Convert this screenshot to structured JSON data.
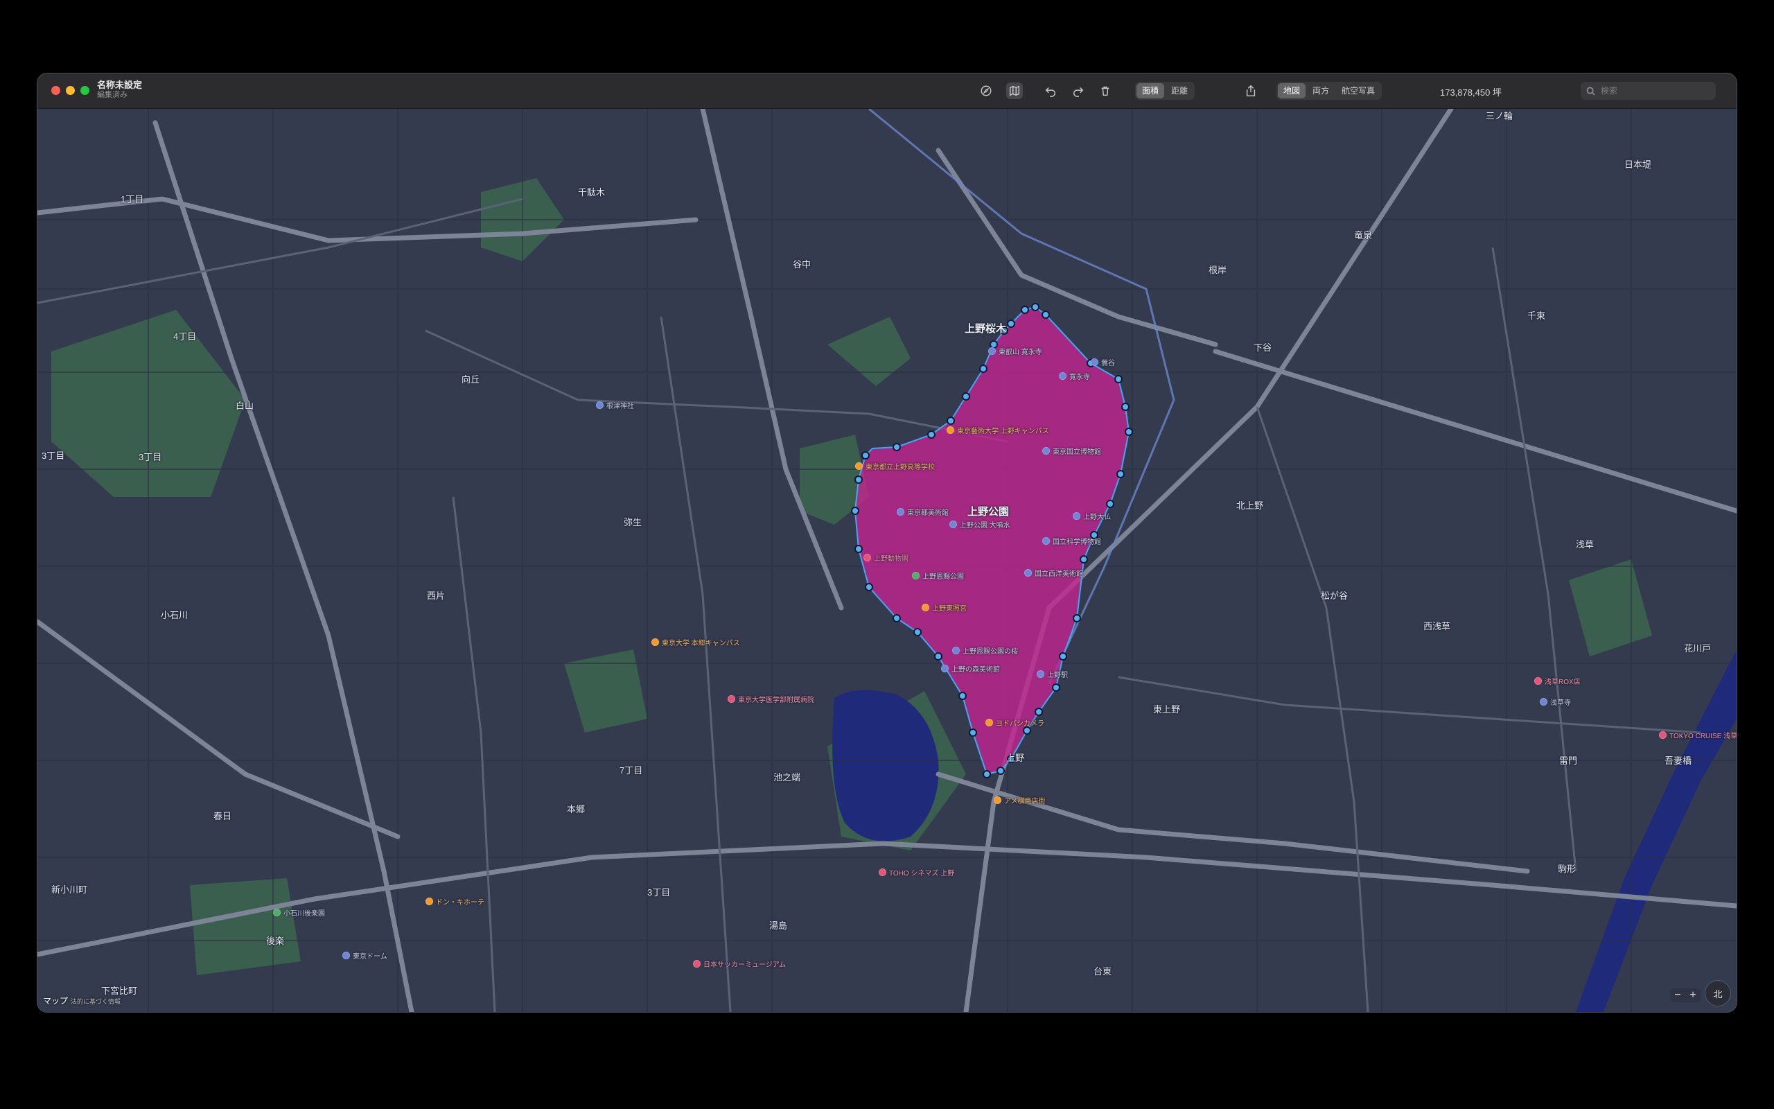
{
  "window": {
    "title": "名称未設定",
    "subtitle": "編集済み"
  },
  "toolbar": {
    "icons": [
      "compass-icon",
      "map-icon",
      "undo-icon",
      "redo-icon",
      "trash-icon"
    ],
    "measure_modes": [
      "面積",
      "距離"
    ],
    "measure_mode_selected": "面積",
    "share_icon": "share-icon",
    "map_types": [
      "地図",
      "両方",
      "航空写真"
    ],
    "map_type_selected": "地図",
    "area_value": "173,878,450 坪",
    "search_placeholder": "検索"
  },
  "map": {
    "district_labels": [
      "上野桜木",
      "上野公園",
      "谷中",
      "千駄木",
      "根岸",
      "下谷",
      "竜泉",
      "三ノ輪",
      "日本堤",
      "千束",
      "北上野",
      "松が谷",
      "浅草",
      "西浅草",
      "花川戸",
      "雷門",
      "吾妻橋",
      "駒形",
      "東上野",
      "上野",
      "台東",
      "湯島",
      "池之端",
      "7丁目",
      "本郷",
      "3丁目",
      "弥生",
      "向丘",
      "西片",
      "白山",
      "小石川",
      "春日",
      "後楽",
      "新小川町",
      "下宮比町",
      "1丁目",
      "4丁目",
      "3丁目",
      "3丁目"
    ],
    "poi_labels": [
      "東京国立博物館",
      "国立科学博物館",
      "国立西洋美術館",
      "上野動物園",
      "上野恩賜公園",
      "東京都美術館",
      "上野公園 大噴水",
      "上野大仏",
      "上野恩賜公園の桜",
      "上野の森美術館",
      "上野東照宮",
      "ヨドバシカメラ",
      "東京藝術大学 上野キャンパス",
      "東京都立上野高等学校",
      "寛永寺",
      "東叡山 寛永寺",
      "アメ横商店街",
      "東京大学 本郷キャンパス",
      "東京大学医学部附属病院",
      "根津神社",
      "浅草寺",
      "浅草ROX店",
      "TOKYO CRUISE 浅草",
      "東京ドーム",
      "小石川後楽園",
      "TOHO シネマズ 上野",
      "日本サッカーミュージアム",
      "ドン・キホーテ",
      "鶯谷",
      "上野駅"
    ],
    "attribution": "マップ",
    "attribution_sub": "法的に基づく情報",
    "compass_label": "北",
    "zoom_out": "−",
    "zoom_in": "+"
  },
  "colors": {
    "selection_fill": "#c2268f",
    "selection_stroke": "#3fa9f5",
    "water": "#1f2a7a",
    "park": "#3c6b4f"
  }
}
